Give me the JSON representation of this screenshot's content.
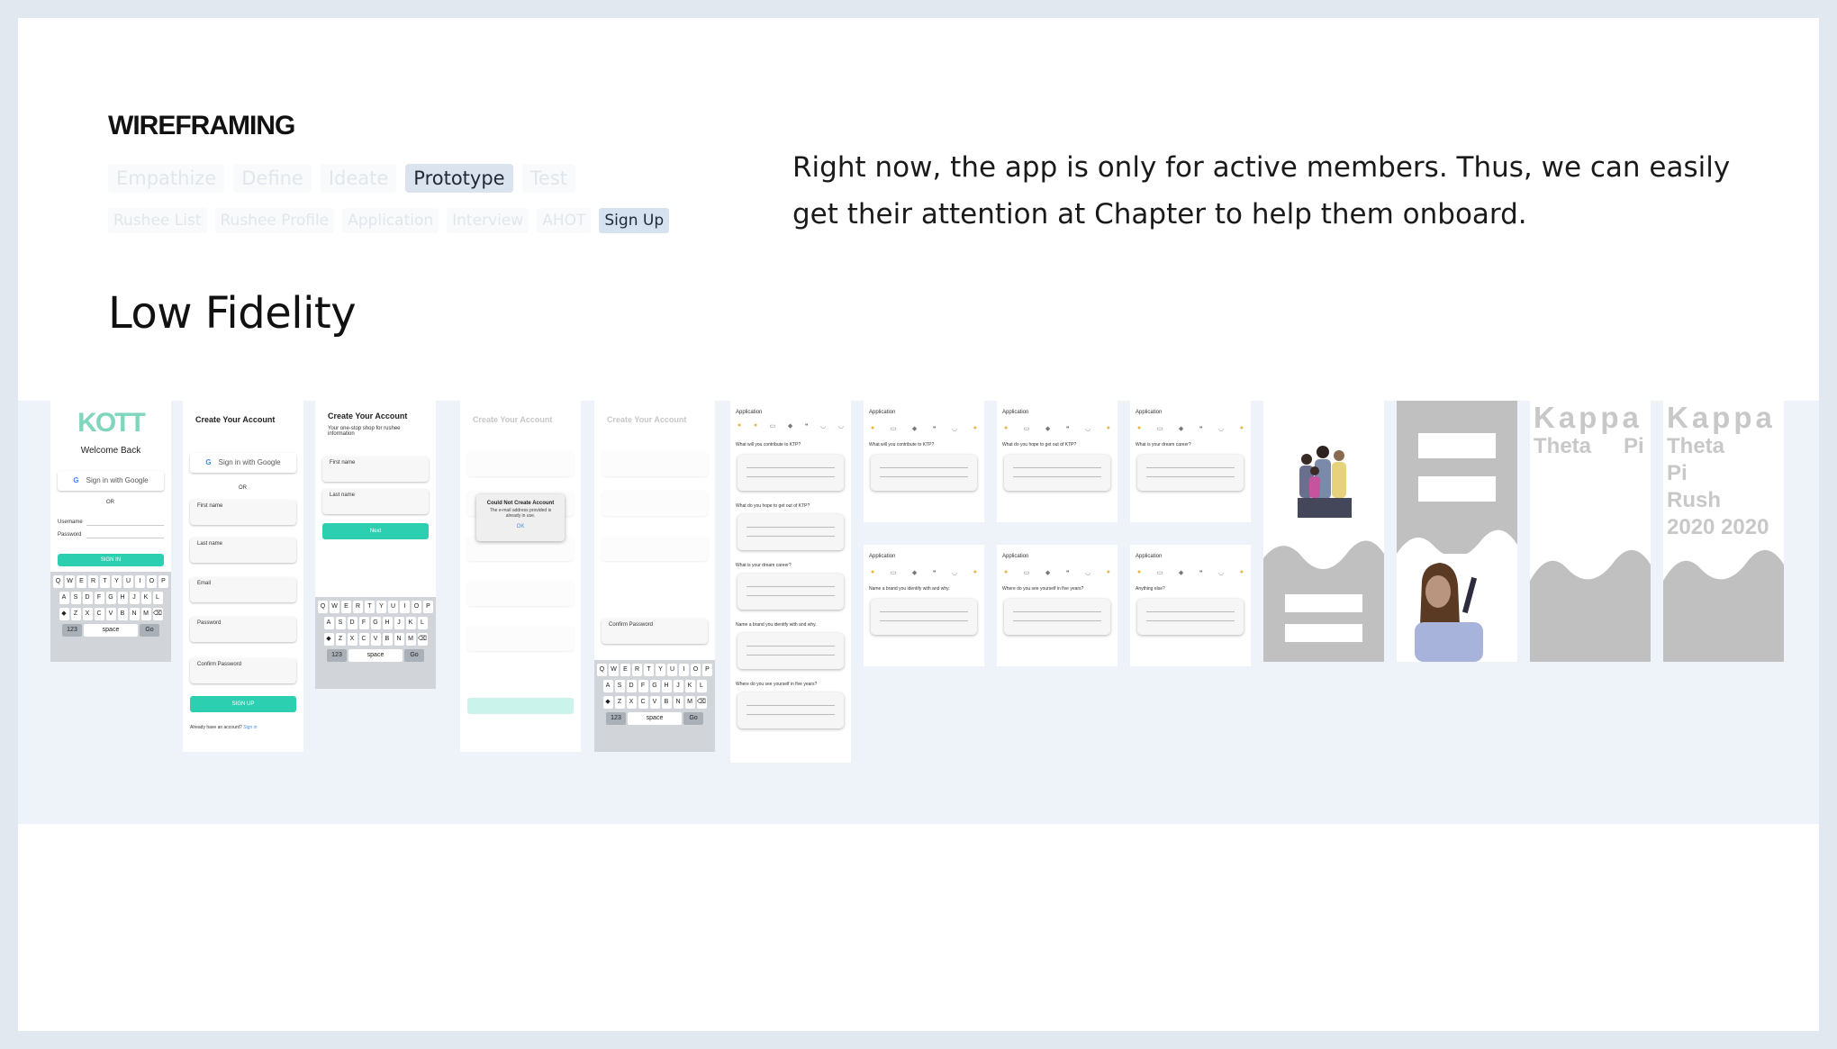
{
  "header": {
    "title": "WIREFRAMING"
  },
  "tabs": [
    "Empathize",
    "Define",
    "Ideate",
    "Prototype",
    "Test"
  ],
  "active_tab": "Prototype",
  "subtabs": [
    "Rushee List",
    "Rushee Profile",
    "Application",
    "Interview",
    "AHOT",
    "Sign Up"
  ],
  "active_subtab": "Sign Up",
  "section_title": "Low Fidelity",
  "description": "Right now, the app is only for active members. Thus, we can easily get their attention at Chapter to help them onboard.",
  "screens": {
    "login": {
      "logo": "KOTT",
      "welcome": "Welcome Back",
      "google": "Sign in with Google",
      "or": "OR",
      "username": "Username",
      "password": "Password",
      "signin": "SIGN IN"
    },
    "create1": {
      "title": "Create Your Account",
      "google": "Sign in with Google",
      "or": "OR",
      "first": "First name",
      "last": "Last name",
      "email": "Email",
      "password": "Password",
      "confirm": "Confirm Password",
      "signup": "SIGN UP",
      "footer": "Already have an account?",
      "footer_link": "Sign in"
    },
    "create2": {
      "title": "Create Your Account",
      "subtitle": "Your one-stop shop for rushee information",
      "first": "First name",
      "last": "Last name",
      "next": "Next"
    },
    "create3": {
      "title": "Create Your Account",
      "dialog_title": "Could Not Create Account",
      "dialog_body": "The e-mail address provided is already in use.",
      "dialog_ok": "OK"
    },
    "create4": {
      "title": "Create Your Account",
      "confirm": "Confirm Password"
    },
    "app_title": "Application",
    "questions": [
      "What will you contribute to KTP?",
      "What do you hope to get out of KTP?",
      "What is your dream career?",
      "Name a brand you identify with and why.",
      "Where do you see yourself in five years?",
      "Anything else?"
    ],
    "kappa1": {
      "line1": "Kappa",
      "line2a": "Theta",
      "line2b": "Pi"
    },
    "kappa2": {
      "line1": "Kappa",
      "line2": "Theta",
      "line3": "Pi",
      "line4": "Rush",
      "line5": "2020 2020"
    }
  },
  "keyboard": {
    "row1": [
      "Q",
      "W",
      "E",
      "R",
      "T",
      "Y",
      "U",
      "I",
      "O",
      "P"
    ],
    "row2": [
      "A",
      "S",
      "D",
      "F",
      "G",
      "H",
      "J",
      "K",
      "L"
    ],
    "row3": [
      "Z",
      "X",
      "C",
      "V",
      "B",
      "N",
      "M"
    ],
    "space": "space",
    "num": "123",
    "go": "Go"
  },
  "colors": {
    "accent": "#2dcfb1",
    "band": "#eef3fa",
    "active_tab": "#dbe4ee"
  }
}
